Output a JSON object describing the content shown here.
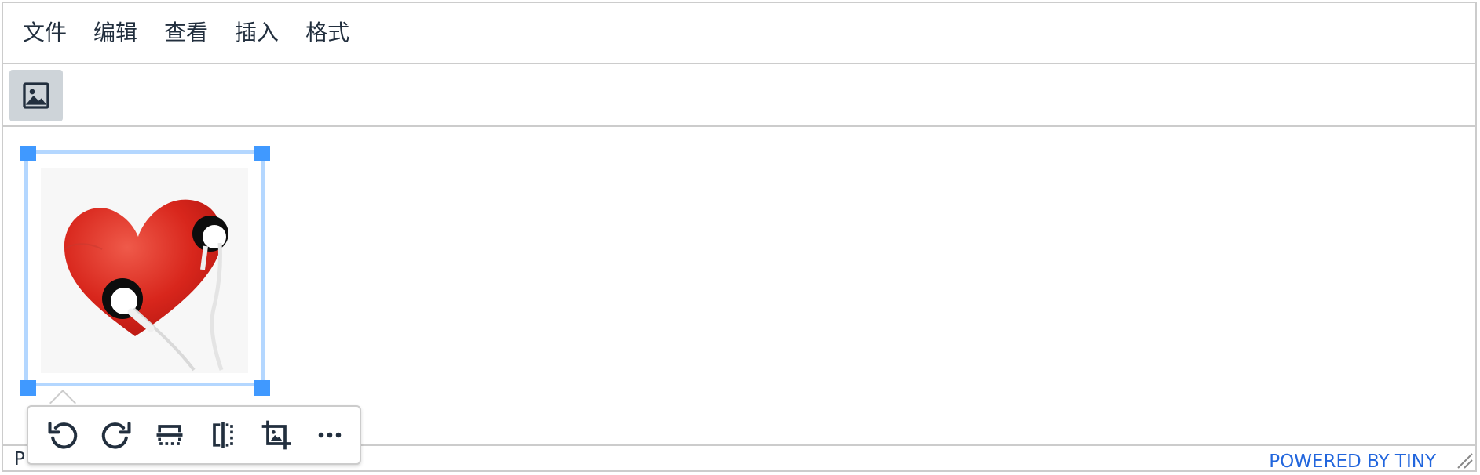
{
  "menubar": {
    "items": [
      "文件",
      "编辑",
      "查看",
      "插入",
      "格式"
    ]
  },
  "toolbar": {
    "buttons": [
      {
        "icon": "image-icon",
        "active": true
      }
    ]
  },
  "content": {
    "image": {
      "description_icon": "heart-earphones-image",
      "selected": true
    }
  },
  "statusbar": {
    "path": "P",
    "branding": "POWERED BY TINY"
  },
  "image_toolbar": {
    "buttons": [
      "rotate-left-icon",
      "rotate-right-icon",
      "flip-vertical-icon",
      "flip-horizontal-icon",
      "crop-icon",
      "more-icon"
    ]
  },
  "colors": {
    "border": "#cccccc",
    "selection": "#b4d7ff",
    "handle": "#4099ff",
    "active_button": "#ced4d9",
    "text": "#222f3e",
    "branding": "#2266dd"
  }
}
